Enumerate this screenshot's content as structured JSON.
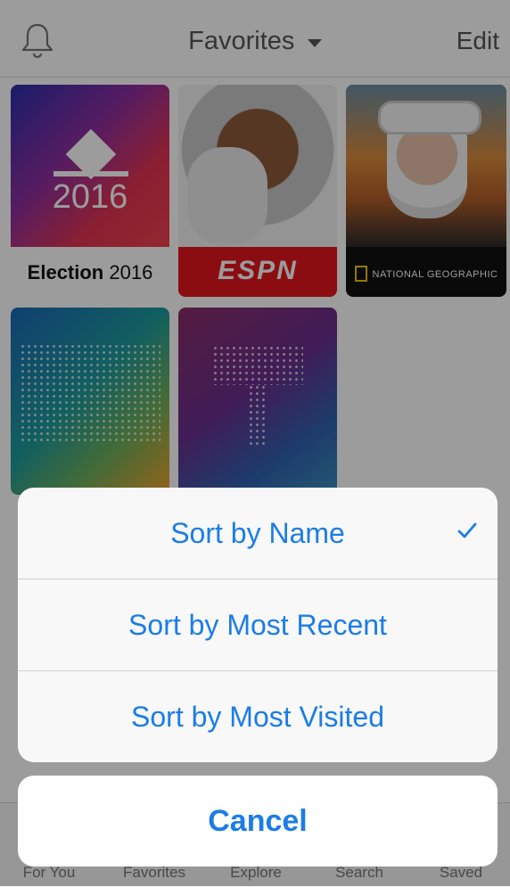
{
  "header": {
    "title": "Favorites",
    "edit": "Edit",
    "bell_icon": "bell-icon",
    "chevron_icon": "chevron-down-icon"
  },
  "tiles": [
    {
      "id": "election",
      "caption_bold": "Election",
      "caption_rest": " 2016",
      "art_text": "2016"
    },
    {
      "id": "espn",
      "logo_text": "ESPN"
    },
    {
      "id": "natgeo",
      "logo_text": "NATIONAL GEOGRAPHIC"
    },
    {
      "id": "world"
    },
    {
      "id": "t"
    }
  ],
  "tabbar": {
    "items": [
      {
        "label": "For You"
      },
      {
        "label": "Favorites"
      },
      {
        "label": "Explore"
      },
      {
        "label": "Search"
      },
      {
        "label": "Saved"
      }
    ]
  },
  "action_sheet": {
    "options": [
      {
        "label": "Sort by Name",
        "selected": true
      },
      {
        "label": "Sort by Most Recent",
        "selected": false
      },
      {
        "label": "Sort by Most Visited",
        "selected": false
      }
    ],
    "cancel_label": "Cancel"
  },
  "colors": {
    "accent": "#1b7de6",
    "overlay": "rgba(0,0,0,0.39)"
  }
}
